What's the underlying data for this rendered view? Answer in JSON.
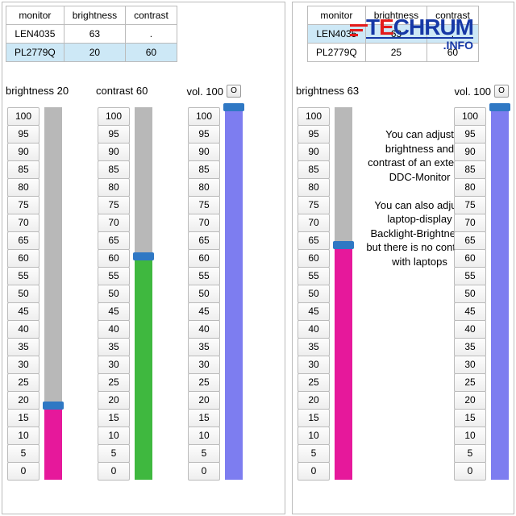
{
  "headers": {
    "monitor": "monitor",
    "brightness": "brightness",
    "contrast": "contrast"
  },
  "left": {
    "rows": [
      {
        "monitor": "LEN4035",
        "brightness": "63",
        "contrast": "."
      },
      {
        "monitor": "PL2779Q",
        "brightness": "20",
        "contrast": "60"
      }
    ],
    "selected": 1,
    "labels": {
      "brightness": "brightness 20",
      "contrast": "contrast 60",
      "vol": "vol. 100",
      "volBtn": "O"
    },
    "sliders": {
      "brightness": {
        "value": 20,
        "fill": "#e6189b",
        "thumb": "#2f78c4"
      },
      "contrast": {
        "value": 60,
        "fill": "#3fb83f",
        "thumb": "#2f78c4"
      },
      "vol": {
        "value": 100,
        "fill": "#7d7df0",
        "thumb": "#2f78c4"
      }
    }
  },
  "right": {
    "rows": [
      {
        "monitor": "LEN4035",
        "brightness": "63",
        "contrast": "."
      },
      {
        "monitor": "PL2779Q",
        "brightness": "25",
        "contrast": "60"
      }
    ],
    "selected": 0,
    "labels": {
      "brightness": "brightness 63",
      "vol": "vol. 100",
      "volBtn": "O"
    },
    "sliders": {
      "brightness": {
        "value": 63,
        "fill": "#e6189b",
        "thumb": "#2f78c4"
      },
      "vol": {
        "value": 100,
        "fill": "#7d7df0",
        "thumb": "#2f78c4"
      }
    },
    "info1": "You can adjust brightness and contrast of an external DDC-Monitor",
    "info2": "You can also adjust laptop-display Backlight-Brightness, but there is no contrast with laptops"
  },
  "ticks": [
    "100",
    "95",
    "90",
    "85",
    "80",
    "75",
    "70",
    "65",
    "60",
    "55",
    "50",
    "45",
    "40",
    "35",
    "30",
    "25",
    "20",
    "15",
    "10",
    "5",
    "0"
  ],
  "logo": {
    "text": "TECHRUM",
    "sub": ".INFO"
  }
}
